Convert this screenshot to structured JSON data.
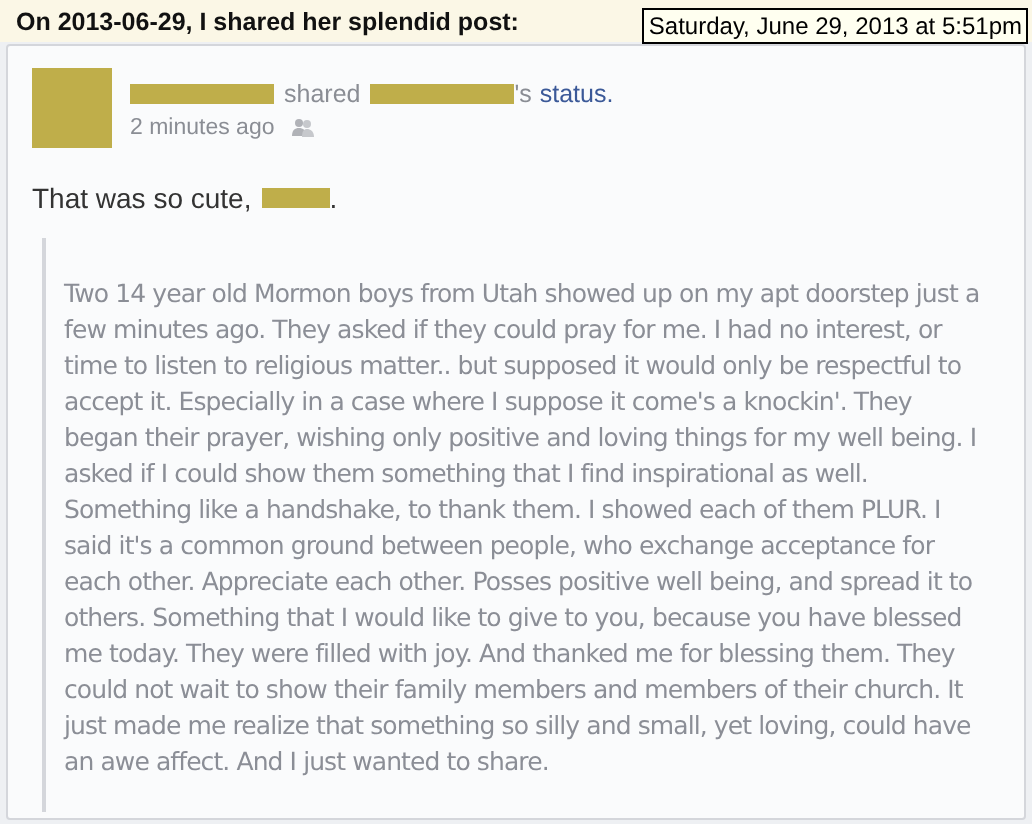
{
  "header": {
    "title": "On 2013-06-29, I shared her splendid post:",
    "tooltip": "Saturday, June 29, 2013 at 5:51pm"
  },
  "post": {
    "shared_word": "shared",
    "possessive": "'s",
    "link": "status.",
    "time": "2 minutes ago",
    "message": "That was so cute,",
    "message_end": ".",
    "quote": "Two 14 year old Mormon boys from Utah showed up on my apt doorstep just a few minutes ago. They asked if they could pray for me. I had no interest, or time to listen to religious matter.. but supposed it would only be respectful to accept it. Especially in a case where I suppose it come's a knockin'. They began their prayer, wishing only positive and loving things for my well being. I asked if I could show them something that I find inspirational as well. Something like a handshake, to thank them. I showed each of them PLUR. I said it's a common ground between people, who exchange acceptance for each other. Appreciate each other. Posses positive well being, and spread it to others. Something that I would like to give to you, because you have blessed me today. They were filled with joy. And thanked me for blessing them. They could not wait to show their family members and members of their church. It just made me realize that something so silly and small, yet loving, could have an awe affect. And I just wanted to share."
  }
}
